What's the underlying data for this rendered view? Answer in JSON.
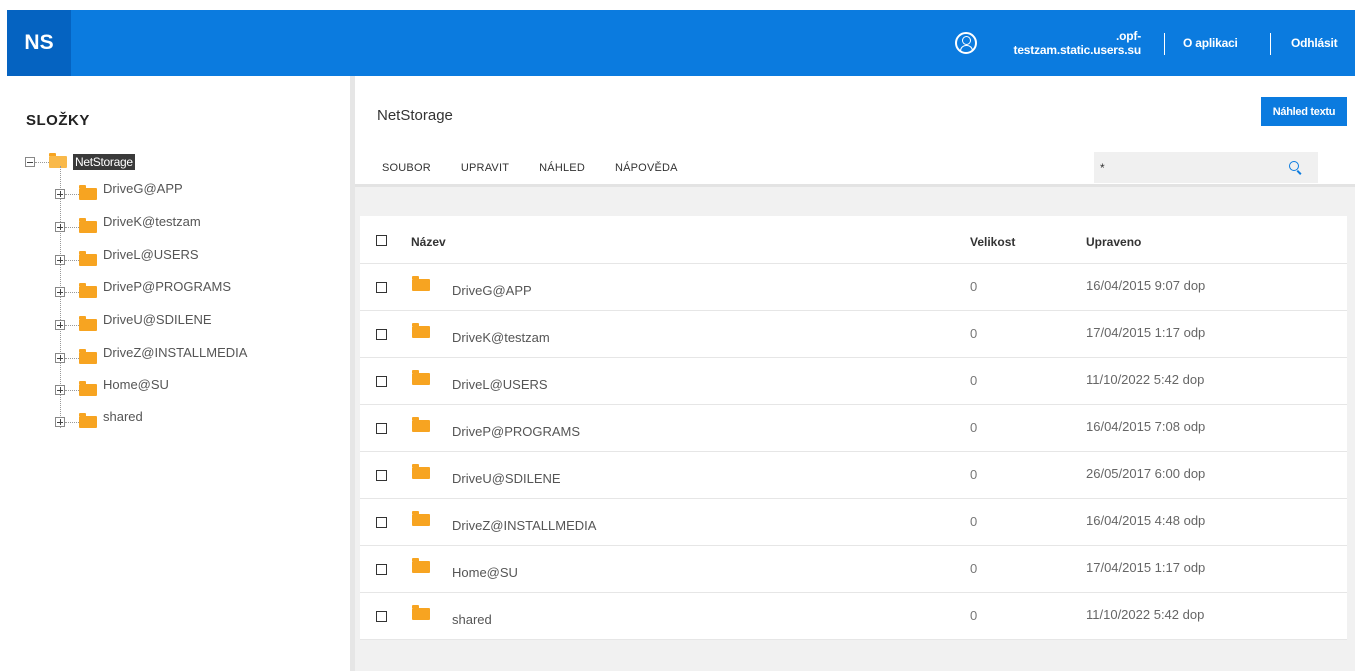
{
  "header": {
    "logo": "NS",
    "user_line1": ".opf-",
    "user_line2": "testzam.static.users.su",
    "about_label": "O aplikaci",
    "logout_label": "Odhlásit"
  },
  "sidebar": {
    "title": "SLOŽKY",
    "root_label": "NetStorage",
    "items": [
      {
        "label": "DriveG@APP"
      },
      {
        "label": "DriveK@testzam"
      },
      {
        "label": "DriveL@USERS"
      },
      {
        "label": "DriveP@PROGRAMS"
      },
      {
        "label": "DriveU@SDILENE"
      },
      {
        "label": "DriveZ@INSTALLMEDIA"
      },
      {
        "label": "Home@SU"
      },
      {
        "label": "shared"
      }
    ]
  },
  "main": {
    "title": "NetStorage",
    "preview_button": "Náhled textu",
    "menu": [
      {
        "label": "SOUBOR"
      },
      {
        "label": "UPRAVIT"
      },
      {
        "label": "NÁHLED"
      },
      {
        "label": "NÁPOVĚDA"
      }
    ],
    "search_value": "*"
  },
  "table": {
    "columns": {
      "name": "Název",
      "size": "Velikost",
      "modified": "Upraveno"
    },
    "rows": [
      {
        "name": "DriveG@APP",
        "size": "0",
        "modified": "16/04/2015 9:07 dop"
      },
      {
        "name": "DriveK@testzam",
        "size": "0",
        "modified": "17/04/2015 1:17 odp"
      },
      {
        "name": "DriveL@USERS",
        "size": "0",
        "modified": "11/10/2022 5:42 dop"
      },
      {
        "name": "DriveP@PROGRAMS",
        "size": "0",
        "modified": "16/04/2015 7:08 odp"
      },
      {
        "name": "DriveU@SDILENE",
        "size": "0",
        "modified": "26/05/2017 6:00 dop"
      },
      {
        "name": "DriveZ@INSTALLMEDIA",
        "size": "0",
        "modified": "16/04/2015 4:48 odp"
      },
      {
        "name": "Home@SU",
        "size": "0",
        "modified": "17/04/2015 1:17 odp"
      },
      {
        "name": "shared",
        "size": "0",
        "modified": "11/10/2022 5:42 dop"
      }
    ]
  },
  "colors": {
    "header_bg": "#0b7bdf",
    "logo_bg": "#0563c1",
    "folder": "#f7a421"
  }
}
